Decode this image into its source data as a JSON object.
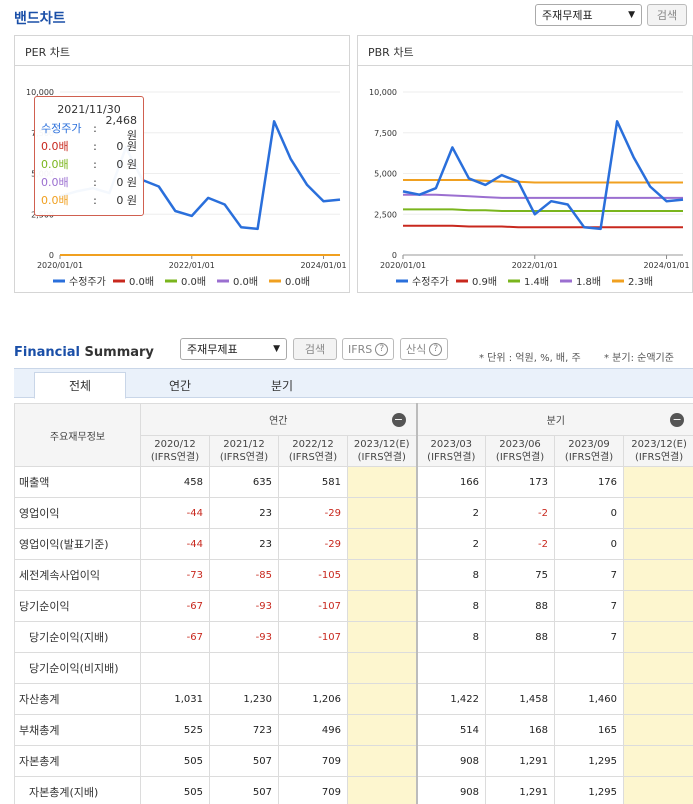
{
  "band_chart": {
    "title": "밴드차트",
    "select_value": "주재무제표",
    "search_label": "검색"
  },
  "per_chart": {
    "title": "PER 차트",
    "y_ticks": [
      "10,000",
      "7,500",
      "5,000",
      "2,500",
      "0"
    ],
    "x_ticks": [
      "2020/01/01",
      "2022/01/01",
      "2024/01/01"
    ],
    "legend": [
      "수정주가",
      "0.0배",
      "0.0배",
      "0.0배",
      "0.0배"
    ],
    "tooltip": {
      "date": "2021/11/30",
      "rows": [
        {
          "label": "수정주가",
          "sep": ":",
          "value": "2,468 원"
        },
        {
          "label": "0.0배",
          "sep": ":",
          "value": "0 원"
        },
        {
          "label": "0.0배",
          "sep": ":",
          "value": "0 원"
        },
        {
          "label": "0.0배",
          "sep": ":",
          "value": "0 원"
        },
        {
          "label": "0.0배",
          "sep": ":",
          "value": "0 원"
        }
      ]
    }
  },
  "pbr_chart": {
    "title": "PBR 차트",
    "y_ticks": [
      "10,000",
      "7,500",
      "5,000",
      "2,500",
      "0"
    ],
    "x_ticks": [
      "2020/01/01",
      "2022/01/01",
      "2024/01/01"
    ],
    "legend": [
      "수정주가",
      "0.9배",
      "1.4배",
      "1.8배",
      "2.3배"
    ]
  },
  "colors": {
    "price": "#2a6fdb",
    "band1": "#c8281e",
    "band2": "#7ab51d",
    "band3": "#9b6fd0",
    "band4": "#f0a020"
  },
  "chart_data": [
    {
      "type": "line",
      "title": "PER 차트",
      "ylim": [
        0,
        10000
      ],
      "x": [
        "2020/01",
        "2020/04",
        "2020/07",
        "2020/10",
        "2021/01",
        "2021/04",
        "2021/07",
        "2021/10",
        "2022/01",
        "2022/04",
        "2022/07",
        "2022/10",
        "2023/01",
        "2023/04",
        "2023/07",
        "2023/10",
        "2024/01",
        "2024/04"
      ],
      "series": [
        {
          "name": "수정주가",
          "values": [
            3600,
            3900,
            4100,
            3800,
            6600,
            4600,
            4200,
            2700,
            2400,
            3500,
            3100,
            1700,
            1600,
            8200,
            5900,
            4300,
            3300,
            3400
          ]
        },
        {
          "name": "0.0배",
          "values": [
            0,
            0,
            0,
            0,
            0,
            0,
            0,
            0,
            0,
            0,
            0,
            0,
            0,
            0,
            0,
            0,
            0,
            0
          ]
        }
      ]
    },
    {
      "type": "line",
      "title": "PBR 차트",
      "ylim": [
        0,
        10000
      ],
      "x": [
        "2020/01",
        "2020/04",
        "2020/07",
        "2020/10",
        "2021/01",
        "2021/04",
        "2021/07",
        "2021/10",
        "2022/01",
        "2022/04",
        "2022/07",
        "2022/10",
        "2023/01",
        "2023/04",
        "2023/07",
        "2023/10",
        "2024/01",
        "2024/04"
      ],
      "series": [
        {
          "name": "수정주가",
          "values": [
            3900,
            3700,
            4100,
            6600,
            4700,
            4300,
            4900,
            4500,
            2500,
            3300,
            3100,
            1700,
            1600,
            8200,
            6000,
            4200,
            3300,
            3400
          ]
        },
        {
          "name": "0.9배",
          "values": [
            1800,
            1800,
            1800,
            1800,
            1750,
            1750,
            1750,
            1700,
            1700,
            1700,
            1700,
            1700,
            1700,
            1700,
            1700,
            1700,
            1700,
            1700
          ]
        },
        {
          "name": "1.4배",
          "values": [
            2800,
            2800,
            2800,
            2800,
            2750,
            2750,
            2700,
            2700,
            2700,
            2700,
            2700,
            2700,
            2700,
            2700,
            2700,
            2700,
            2700,
            2700
          ]
        },
        {
          "name": "1.8배",
          "values": [
            3700,
            3700,
            3700,
            3650,
            3600,
            3550,
            3500,
            3500,
            3500,
            3500,
            3500,
            3500,
            3500,
            3500,
            3500,
            3500,
            3500,
            3500
          ]
        },
        {
          "name": "2.3배",
          "values": [
            4600,
            4600,
            4600,
            4600,
            4600,
            4550,
            4500,
            4500,
            4450,
            4450,
            4450,
            4450,
            4450,
            4450,
            4450,
            4450,
            4450,
            4450
          ]
        }
      ]
    }
  ],
  "financial_summary": {
    "title_prefix": "Financial",
    "title_suffix": " Summary",
    "select_value": "주재무제표",
    "search_label": "검색",
    "ifrs_label": "IFRS",
    "calc_label": "산식",
    "unit_note": "* 단위 : 억원, %, 배, 주",
    "basis_note": "* 분기: 순액기준",
    "tabs": [
      "전체",
      "연간",
      "분기"
    ],
    "header": {
      "main_label": "주요재무정보",
      "annual_label": "연간",
      "quarter_label": "분기",
      "sub_note": "(IFRS연결)",
      "annual_periods": [
        "2020/12",
        "2021/12",
        "2022/12",
        "2023/12(E)"
      ],
      "quarter_periods": [
        "2023/03",
        "2023/06",
        "2023/09",
        "2023/12(E)"
      ]
    },
    "rows": [
      {
        "label": "매출액",
        "annual": [
          "458",
          "635",
          "581",
          ""
        ],
        "quarter": [
          "166",
          "173",
          "176",
          ""
        ]
      },
      {
        "label": "영업이익",
        "annual": [
          "-44",
          "23",
          "-29",
          ""
        ],
        "quarter": [
          "2",
          "-2",
          "0",
          ""
        ]
      },
      {
        "label": "영업이익(발표기준)",
        "annual": [
          "-44",
          "23",
          "-29",
          ""
        ],
        "quarter": [
          "2",
          "-2",
          "0",
          ""
        ]
      },
      {
        "label": "세전계속사업이익",
        "annual": [
          "-73",
          "-85",
          "-105",
          ""
        ],
        "quarter": [
          "8",
          "75",
          "7",
          ""
        ]
      },
      {
        "label": "당기순이익",
        "annual": [
          "-67",
          "-93",
          "-107",
          ""
        ],
        "quarter": [
          "8",
          "88",
          "7",
          ""
        ]
      },
      {
        "label": "당기순이익(지배)",
        "annual": [
          "-67",
          "-93",
          "-107",
          ""
        ],
        "quarter": [
          "8",
          "88",
          "7",
          ""
        ]
      },
      {
        "label": "당기순이익(비지배)",
        "annual": [
          "",
          "",
          "",
          ""
        ],
        "quarter": [
          "",
          "",
          "",
          ""
        ]
      },
      {
        "label": "자산총계",
        "annual": [
          "1,031",
          "1,230",
          "1,206",
          ""
        ],
        "quarter": [
          "1,422",
          "1,458",
          "1,460",
          ""
        ]
      },
      {
        "label": "부채총계",
        "annual": [
          "525",
          "723",
          "496",
          ""
        ],
        "quarter": [
          "514",
          "168",
          "165",
          ""
        ]
      },
      {
        "label": "자본총계",
        "annual": [
          "505",
          "507",
          "709",
          ""
        ],
        "quarter": [
          "908",
          "1,291",
          "1,295",
          ""
        ]
      },
      {
        "label": "자본총계(지배)",
        "annual": [
          "505",
          "507",
          "709",
          ""
        ],
        "quarter": [
          "908",
          "1,291",
          "1,295",
          ""
        ]
      }
    ]
  }
}
